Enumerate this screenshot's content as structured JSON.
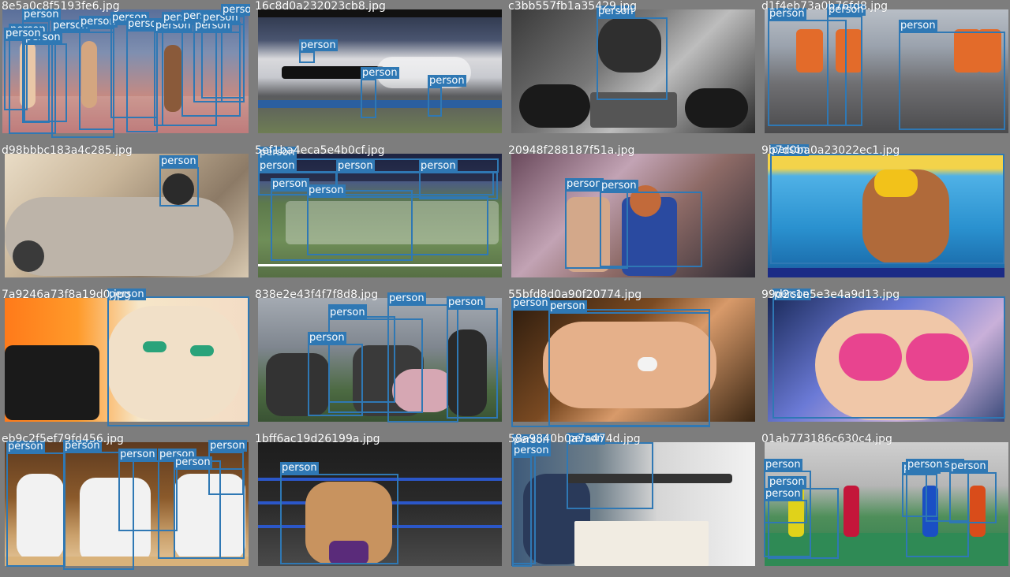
{
  "box_color": "#2f78b4",
  "cells": [
    {
      "filename": "8e5a0c8f5193fe6.jpg",
      "scene": "sprinters-track",
      "boxes": [
        {
          "label": "person"
        },
        {
          "label": "person"
        },
        {
          "label": "person"
        },
        {
          "label": "person"
        },
        {
          "label": "person"
        },
        {
          "label": "person"
        },
        {
          "label": "person"
        },
        {
          "label": "person"
        },
        {
          "label": "person"
        },
        {
          "label": "person"
        },
        {
          "label": "person"
        },
        {
          "label": "person"
        },
        {
          "label": "person"
        },
        {
          "label": "person"
        }
      ]
    },
    {
      "filename": "16c8d0a232023cb8.jpg",
      "scene": "dragster-race",
      "boxes": [
        {
          "label": "person"
        },
        {
          "label": "person"
        },
        {
          "label": "person"
        }
      ]
    },
    {
      "filename": "c3bb557fb1a35429.jpg",
      "scene": "dj-turntables",
      "boxes": [
        {
          "label": "person"
        }
      ]
    },
    {
      "filename": "d1f4eb73a0b76fd8.jpg",
      "scene": "workers-hi-vis",
      "boxes": [
        {
          "label": "person"
        },
        {
          "label": "person"
        },
        {
          "label": "person"
        }
      ]
    },
    {
      "filename": "d98bbbc183a4c285.jpg",
      "scene": "vintage-car",
      "boxes": [
        {
          "label": "person"
        }
      ]
    },
    {
      "filename": "5ef1ba4eca5e4b0cf.jpg",
      "scene": "football-stadium",
      "boxes": [
        {
          "label": "person"
        },
        {
          "label": "person"
        },
        {
          "label": "person"
        },
        {
          "label": "person"
        },
        {
          "label": "person"
        },
        {
          "label": "person"
        }
      ]
    },
    {
      "filename": "20948f288187f51a.jpg",
      "scene": "couple-window",
      "boxes": [
        {
          "label": "person"
        },
        {
          "label": "person"
        }
      ]
    },
    {
      "filename": "9b7d0ba0a23022ec1.jpg",
      "scene": "swimmer",
      "boxes": [
        {
          "label": "person"
        }
      ]
    },
    {
      "filename": "7a9246a73f8a19d0.jpg",
      "scene": "illustration-woman",
      "boxes": [
        {
          "label": "person"
        }
      ]
    },
    {
      "filename": "838e2e43f4f7f8d8.jpg",
      "scene": "paintball",
      "boxes": [
        {
          "label": "person"
        },
        {
          "label": "person"
        },
        {
          "label": "person"
        },
        {
          "label": "person"
        },
        {
          "label": "person"
        }
      ]
    },
    {
      "filename": "55bfd8d0a90f20774.jpg",
      "scene": "holding-hands-ring",
      "boxes": [
        {
          "label": "person"
        },
        {
          "label": "person"
        }
      ]
    },
    {
      "filename": "99d2c1e5e3e4a9d13.jpg",
      "scene": "girl-pink-sunglasses",
      "boxes": [
        {
          "label": "person"
        }
      ]
    },
    {
      "filename": "eb9c2f5ef79fd456.jpg",
      "scene": "karate",
      "boxes": [
        {
          "label": "person"
        },
        {
          "label": "person"
        },
        {
          "label": "person"
        },
        {
          "label": "person"
        },
        {
          "label": "person"
        },
        {
          "label": "person"
        }
      ]
    },
    {
      "filename": "1bff6ac19d26199a.jpg",
      "scene": "boxing-kid",
      "boxes": [
        {
          "label": "person"
        }
      ]
    },
    {
      "filename": "58a9840b0a7a474d.jpg",
      "scene": "rifle-shooter",
      "boxes": [
        {
          "label": "person"
        },
        {
          "label": "person"
        },
        {
          "label": "person"
        }
      ]
    },
    {
      "filename": "01ab773186c630c4.jpg",
      "scene": "gym-students",
      "boxes": [
        {
          "label": "person"
        },
        {
          "label": "person"
        },
        {
          "label": "person"
        },
        {
          "label": "person"
        },
        {
          "label": "person"
        },
        {
          "label": "person"
        },
        {
          "label": "person"
        }
      ]
    }
  ]
}
